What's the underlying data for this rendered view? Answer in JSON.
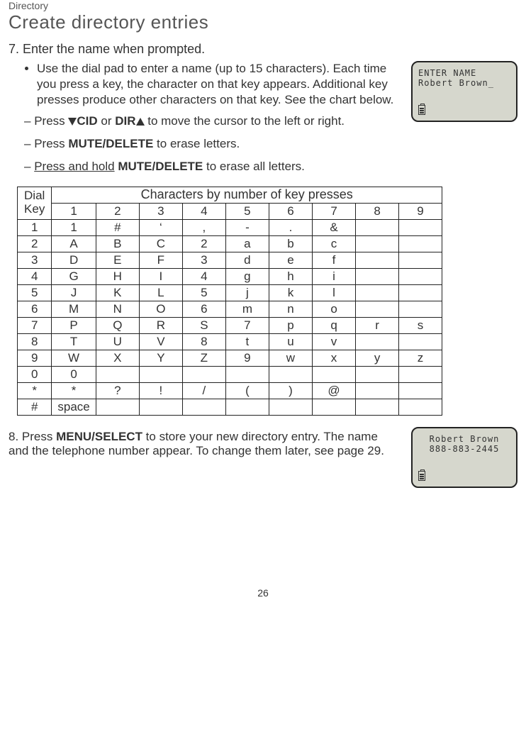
{
  "breadcrumb": "Directory",
  "title": "Create directory entries",
  "step7": {
    "num": "7.",
    "text": "Enter the name when prompted.",
    "bullet": "Use the dial pad to enter a name (up to 15 characters). Each time you press a key, the character on that key appears. Additional key presses produce other characters on that key. See the chart below.",
    "dash1_pre": "Press ",
    "dash1_cid": "CID",
    "dash1_or": " or ",
    "dash1_dir": "DIR",
    "dash1_post": " to move the cursor to the left or right.",
    "dash2_pre": "Press ",
    "dash2_key": "MUTE/DELETE",
    "dash2_post": " to erase letters.",
    "dash3_pre": "Press and hold",
    "dash3_key": "MUTE/DELETE",
    "dash3_post": " to erase all letters."
  },
  "lcd1": {
    "line1": "ENTER NAME",
    "line2": "Robert Brown_"
  },
  "table": {
    "dial_key": "Dial Key",
    "header": "Characters by number of key presses",
    "cols": [
      "1",
      "2",
      "3",
      "4",
      "5",
      "6",
      "7",
      "8",
      "9"
    ],
    "rows": [
      {
        "k": "1",
        "c": [
          "1",
          "#",
          "‘",
          ",",
          "-",
          ".",
          "&",
          "",
          ""
        ]
      },
      {
        "k": "2",
        "c": [
          "A",
          "B",
          "C",
          "2",
          "a",
          "b",
          "c",
          "",
          ""
        ]
      },
      {
        "k": "3",
        "c": [
          "D",
          "E",
          "F",
          "3",
          "d",
          "e",
          "f",
          "",
          ""
        ]
      },
      {
        "k": "4",
        "c": [
          "G",
          "H",
          "I",
          "4",
          "g",
          "h",
          "i",
          "",
          ""
        ]
      },
      {
        "k": "5",
        "c": [
          "J",
          "K",
          "L",
          "5",
          "j",
          "k",
          "l",
          "",
          ""
        ]
      },
      {
        "k": "6",
        "c": [
          "M",
          "N",
          "O",
          "6",
          "m",
          "n",
          "o",
          "",
          ""
        ]
      },
      {
        "k": "7",
        "c": [
          "P",
          "Q",
          "R",
          "S",
          "7",
          "p",
          "q",
          "r",
          "s"
        ]
      },
      {
        "k": "8",
        "c": [
          "T",
          "U",
          "V",
          "8",
          "t",
          "u",
          "v",
          "",
          ""
        ]
      },
      {
        "k": "9",
        "c": [
          "W",
          "X",
          "Y",
          "Z",
          "9",
          "w",
          "x",
          "y",
          "z"
        ]
      },
      {
        "k": "0",
        "c": [
          "0",
          "",
          "",
          "",
          "",
          "",
          "",
          "",
          ""
        ]
      },
      {
        "k": "*",
        "c": [
          "*",
          "?",
          "!",
          "/",
          "(",
          ")",
          "@",
          "",
          ""
        ]
      },
      {
        "k": "#",
        "c": [
          "space",
          "",
          "",
          "",
          "",
          "",
          "",
          "",
          ""
        ]
      }
    ]
  },
  "step8": {
    "num": "8.",
    "pre": "Press ",
    "key": "MENU/SELECT",
    "post": " to store your new directory entry. The name and the telephone number appear. To change them later, see page 29."
  },
  "lcd2": {
    "line1": "Robert Brown",
    "line2": "888-883-2445"
  },
  "page_num": "26"
}
